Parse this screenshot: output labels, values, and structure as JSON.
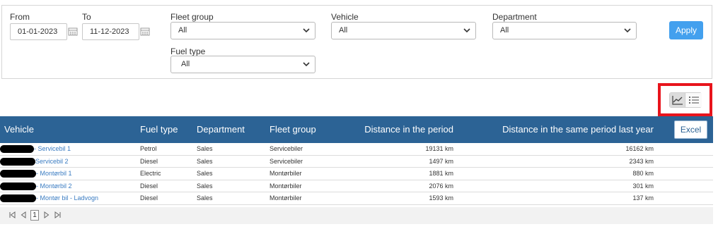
{
  "filters": {
    "from": {
      "label": "From",
      "value": "01-01-2023"
    },
    "to": {
      "label": "To",
      "value": "11-12-2023"
    },
    "fleet_group": {
      "label": "Fleet group",
      "value": "All"
    },
    "vehicle": {
      "label": "Vehicle",
      "value": "All"
    },
    "department": {
      "label": "Department",
      "value": "All"
    },
    "fuel_type": {
      "label": "Fuel type",
      "value": "All"
    },
    "apply_label": "Apply"
  },
  "view_toggle": {
    "chart_icon": "line-chart-icon",
    "list_icon": "list-icon",
    "active": "chart"
  },
  "table": {
    "columns": [
      "Vehicle",
      "Fuel type",
      "Department",
      "Fleet group",
      "Distance in the period",
      "Distance in the same period last year"
    ],
    "excel_label": "Excel",
    "rows": [
      {
        "vehicle": "- Servicebil 1",
        "fuel": "Petrol",
        "department": "Sales",
        "fleet_group": "Servicebiler",
        "distance": "19131 km",
        "last_year": "16162 km"
      },
      {
        "vehicle": "Servicebil 2",
        "fuel": "Diesel",
        "department": "Sales",
        "fleet_group": "Servicebiler",
        "distance": "1497 km",
        "last_year": "2343 km"
      },
      {
        "vehicle": "- Montørbil 1",
        "fuel": "Electric",
        "department": "Sales",
        "fleet_group": "Montørbiler",
        "distance": "1881 km",
        "last_year": "880 km"
      },
      {
        "vehicle": "- Montørbil 2",
        "fuel": "Diesel",
        "department": "Sales",
        "fleet_group": "Montørbiler",
        "distance": "2076 km",
        "last_year": "301 km"
      },
      {
        "vehicle": "- Montør bil - Ladvogn",
        "fuel": "Diesel",
        "department": "Sales",
        "fleet_group": "Montørbiler",
        "distance": "1593 km",
        "last_year": "137 km"
      }
    ]
  },
  "pager": {
    "current_page": "1"
  },
  "colors": {
    "header_bg": "#2c6395",
    "apply_bg": "#43a0ee",
    "highlight_border": "#e8141c",
    "link": "#3a7cc2"
  }
}
